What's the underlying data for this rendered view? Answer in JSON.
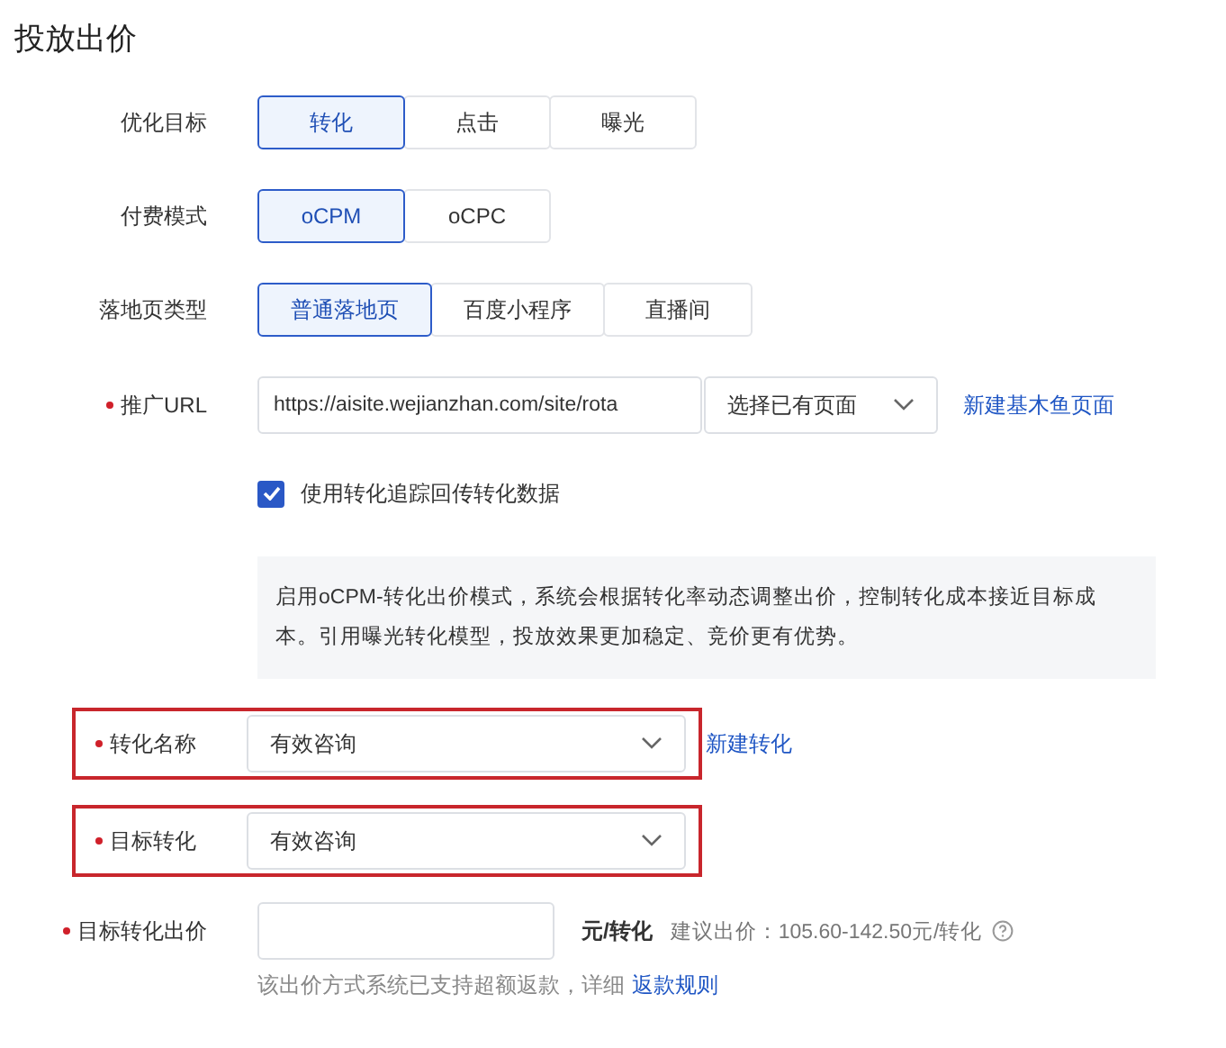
{
  "title": "投放出价",
  "fields": [
    {
      "kind": "segmented",
      "label": "优化目标",
      "required": false,
      "options": [
        {
          "label": "转化",
          "selected": true
        },
        {
          "label": "点击",
          "selected": false
        },
        {
          "label": "曝光",
          "selected": false
        }
      ]
    },
    {
      "kind": "segmented",
      "label": "付费模式",
      "required": false,
      "options": [
        {
          "label": "oCPM",
          "selected": true
        },
        {
          "label": "oCPC",
          "selected": false
        }
      ]
    },
    {
      "kind": "segmented",
      "label": "落地页类型",
      "required": false,
      "options": [
        {
          "label": "普通落地页",
          "selected": true
        },
        {
          "label": "百度小程序",
          "selected": false
        },
        {
          "label": "直播间",
          "selected": false
        }
      ]
    },
    {
      "kind": "url",
      "label": "推广URL",
      "required": true,
      "value": "https://aisite.wejianzhan.com/site/rota",
      "select": "选择已有页面",
      "link": "新建基木鱼页面"
    },
    {
      "kind": "checkbox",
      "label": "使用转化追踪回传转化数据",
      "checked": true
    },
    {
      "kind": "info",
      "text": "启用oCPM-转化出价模式，系统会根据转化率动态调整出价，控制转化成本接近目标成本。引用曝光转化模型，投放效果更加稳定、竞价更有优势。"
    },
    {
      "kind": "select",
      "label": "转化名称",
      "required": true,
      "highlighted": true,
      "value": "有效咨询",
      "link": "新建转化"
    },
    {
      "kind": "select",
      "label": "目标转化",
      "required": true,
      "highlighted": true,
      "value": "有效咨询"
    },
    {
      "kind": "price",
      "label": "目标转化出价",
      "required": true,
      "unit": "元/转化",
      "suggestion": "建议出价：105.60-142.50元/转化",
      "note": "该出价方式系统已支持超额返款，详细",
      "note_link": "返款规则"
    }
  ]
}
